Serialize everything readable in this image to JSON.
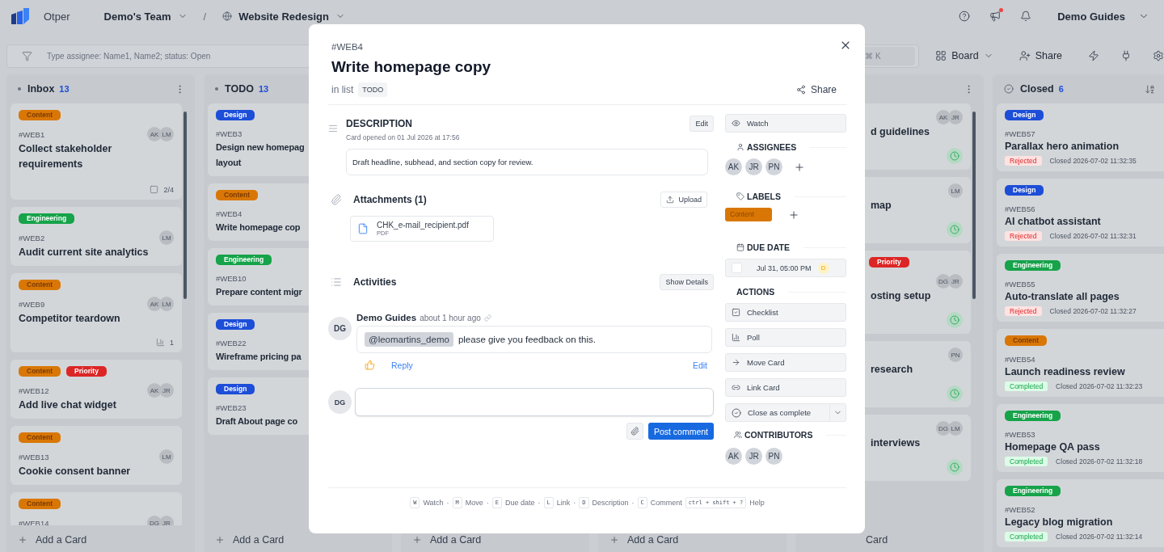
{
  "app": {
    "name": "Otper"
  },
  "breadcrumb": {
    "team": "Demo's Team",
    "separator": "/",
    "project": "Website Redesign"
  },
  "header": {
    "announcements_unread": true,
    "user": "Demo Guides"
  },
  "filter_bar": {
    "placeholder": "Type assignee: Name1, Name2; status: Open",
    "search_shortcut": "⌘ K"
  },
  "toolbar": {
    "view": "Board",
    "share": "Share"
  },
  "columns": [
    {
      "kind": "full",
      "title": "Inbox",
      "count": "13",
      "add_label": "Add a Card",
      "cards": [
        {
          "labels": [
            {
              "text": "Content",
              "color": "#d97706"
            }
          ],
          "ref": "#WEB1",
          "title": "Collect stakeholder requirements",
          "assignees": [
            "AK",
            "LM"
          ],
          "footer": {
            "kind": "checklist",
            "text": "2/4"
          }
        },
        {
          "labels": [
            {
              "text": "Engineering",
              "color": "#16a34a"
            }
          ],
          "ref": "#WEB2",
          "title": "Audit current site analytics",
          "assignees": [
            "LM"
          ]
        },
        {
          "labels": [
            {
              "text": "Content",
              "color": "#d97706"
            }
          ],
          "ref": "#WEB9",
          "title": "Competitor teardown",
          "assignees": [
            "AK",
            "LM"
          ],
          "footer": {
            "kind": "poll",
            "text": "1"
          }
        },
        {
          "labels": [
            {
              "text": "Content",
              "color": "#d97706"
            },
            {
              "text": "Priority",
              "color": "#dc2626"
            }
          ],
          "ref": "#WEB12",
          "title": "Add live chat widget",
          "assignees": [
            "AK",
            "JR"
          ]
        },
        {
          "labels": [
            {
              "text": "Content",
              "color": "#d97706"
            }
          ],
          "ref": "#WEB13",
          "title": "Cookie consent banner",
          "assignees": [
            "LM"
          ]
        },
        {
          "labels": [
            {
              "text": "Content",
              "color": "#d97706"
            }
          ],
          "ref": "#WEB14",
          "assignees": [
            "DG",
            "JR"
          ]
        }
      ]
    },
    {
      "kind": "full",
      "title": "TODO",
      "count": "13",
      "add_label": "Add a Card",
      "cards": [
        {
          "labels": [
            {
              "text": "Design",
              "color": "#1d4ed8"
            }
          ],
          "ref": "#WEB3",
          "title_lines": [
            "Design new homepag",
            "layout"
          ]
        },
        {
          "labels": [
            {
              "text": "Content",
              "color": "#d97706"
            }
          ],
          "ref": "#WEB4",
          "title": "Write homepage cop"
        },
        {
          "labels": [
            {
              "text": "Engineering",
              "color": "#16a34a"
            }
          ],
          "ref": "#WEB10",
          "title": "Prepare content migr"
        },
        {
          "labels": [
            {
              "text": "Design",
              "color": "#1d4ed8"
            }
          ],
          "ref": "#WEB22",
          "title": "Wireframe pricing pa"
        },
        {
          "labels": [
            {
              "text": "Design",
              "color": "#1d4ed8"
            }
          ],
          "ref": "#WEB23",
          "title": "Draft About page co"
        }
      ]
    },
    {
      "kind": "hidden",
      "add_label": "Add a Card"
    },
    {
      "kind": "hidden",
      "add_label": "Add a Card"
    },
    {
      "kind": "partial",
      "add_label": "Card",
      "cards": [
        {
          "title": "d guidelines",
          "assignees": [
            "AK",
            "JR"
          ],
          "footer": {
            "kind": "due"
          }
        },
        {
          "title": "map",
          "assignees": [
            "LM"
          ],
          "footer": {
            "kind": "due"
          }
        },
        {
          "labels": [
            {
              "text": "Priority",
              "color": "#dc2626"
            }
          ],
          "title": "osting setup",
          "assignees": [
            "DG",
            "JR"
          ],
          "footer": {
            "kind": "due"
          }
        },
        {
          "title": "research",
          "assignees": [
            "PN"
          ],
          "footer": {
            "kind": "due"
          }
        },
        {
          "title": "interviews",
          "assignees": [
            "DG",
            "LM"
          ],
          "footer": {
            "kind": "due"
          }
        }
      ]
    },
    {
      "kind": "closed",
      "title": "Closed",
      "count": "6",
      "cards": [
        {
          "labels": [
            {
              "text": "Design",
              "color": "#1d4ed8"
            }
          ],
          "ref": "#WEB57",
          "title": "Parallax hero animation",
          "status": {
            "kind": "rejected",
            "text": "Rejected"
          },
          "closed_at": "Closed 2026-07-02 11:32:35"
        },
        {
          "labels": [
            {
              "text": "Design",
              "color": "#1d4ed8"
            }
          ],
          "ref": "#WEB56",
          "title": "AI chatbot assistant",
          "status": {
            "kind": "rejected",
            "text": "Rejected"
          },
          "closed_at": "Closed 2026-07-02 11:32:31"
        },
        {
          "labels": [
            {
              "text": "Engineering",
              "color": "#16a34a"
            }
          ],
          "ref": "#WEB55",
          "title": "Auto-translate all pages",
          "status": {
            "kind": "rejected",
            "text": "Rejected"
          },
          "closed_at": "Closed 2026-07-02 11:32:27"
        },
        {
          "labels": [
            {
              "text": "Content",
              "color": "#d97706"
            }
          ],
          "ref": "#WEB54",
          "title": "Launch readiness review",
          "status": {
            "kind": "completed",
            "text": "Completed"
          },
          "closed_at": "Closed 2026-07-02 11:32:23"
        },
        {
          "labels": [
            {
              "text": "Engineering",
              "color": "#16a34a"
            }
          ],
          "ref": "#WEB53",
          "title": "Homepage QA pass",
          "status": {
            "kind": "completed",
            "text": "Completed"
          },
          "closed_at": "Closed 2026-07-02 11:32:18"
        },
        {
          "labels": [
            {
              "text": "Engineering",
              "color": "#16a34a"
            }
          ],
          "ref": "#WEB52",
          "title": "Legacy blog migration",
          "status": {
            "kind": "completed",
            "text": "Completed"
          },
          "closed_at": "Closed 2026-07-02 11:32:14"
        }
      ]
    }
  ],
  "card_detail": {
    "ref": "#WEB4",
    "title": "Write homepage copy",
    "list_prefix": "in list",
    "list_name": "TODO",
    "share": "Share",
    "description": {
      "heading": "DESCRIPTION",
      "opened": "Card opened on 01 Jul 2026 at 17:56",
      "edit": "Edit",
      "text": "Draft headline, subhead, and section copy for review."
    },
    "attachments": {
      "heading": "Attachments (1)",
      "upload": "Upload",
      "files": [
        {
          "name": "CHK_e-mail_recipient.pdf",
          "type": "PDF"
        }
      ]
    },
    "activities": {
      "heading": "Activities",
      "toggle": "Show Details",
      "comments": [
        {
          "initials": "DG",
          "author": "Demo Guides",
          "time": "about 1 hour ago",
          "mention": "@leomartins_demo",
          "text": "please give you feedback on this.",
          "reply": "Reply",
          "edit": "Edit"
        }
      ]
    },
    "composer": {
      "initials": "DG",
      "post": "Post comment"
    },
    "sidebar": {
      "watch": "Watch",
      "assignees": {
        "heading": "ASSIGNEES",
        "people": [
          "AK",
          "JR",
          "PN"
        ]
      },
      "labels": {
        "heading": "LABELS",
        "items": [
          {
            "text": "Content",
            "color": "#d97706"
          }
        ]
      },
      "due_date": {
        "heading": "DUE DATE",
        "checked": false,
        "value": "Jul 31, 05:00 PM",
        "badge": "D"
      },
      "actions": {
        "heading": "ACTIONS",
        "items": [
          {
            "kind": "checklist",
            "label": "Checklist"
          },
          {
            "kind": "poll",
            "label": "Poll"
          },
          {
            "kind": "move",
            "label": "Move Card"
          },
          {
            "kind": "link",
            "label": "Link Card"
          },
          {
            "kind": "close",
            "label": "Close as complete"
          }
        ]
      },
      "contributors": {
        "heading": "CONTRIBUTORS",
        "people": [
          "AK",
          "JR",
          "PN"
        ]
      }
    },
    "shortcuts": {
      "separator": "·",
      "items": [
        {
          "key": "W",
          "label": "Watch"
        },
        {
          "key": "M",
          "label": "Move"
        },
        {
          "key": "E",
          "label": "Due date"
        },
        {
          "key": "L",
          "label": "Link"
        },
        {
          "key": "D",
          "label": "Description"
        },
        {
          "key": "C",
          "label": "Comment"
        },
        {
          "key": "ctrl + shift + ?",
          "label": "Help"
        }
      ]
    }
  }
}
